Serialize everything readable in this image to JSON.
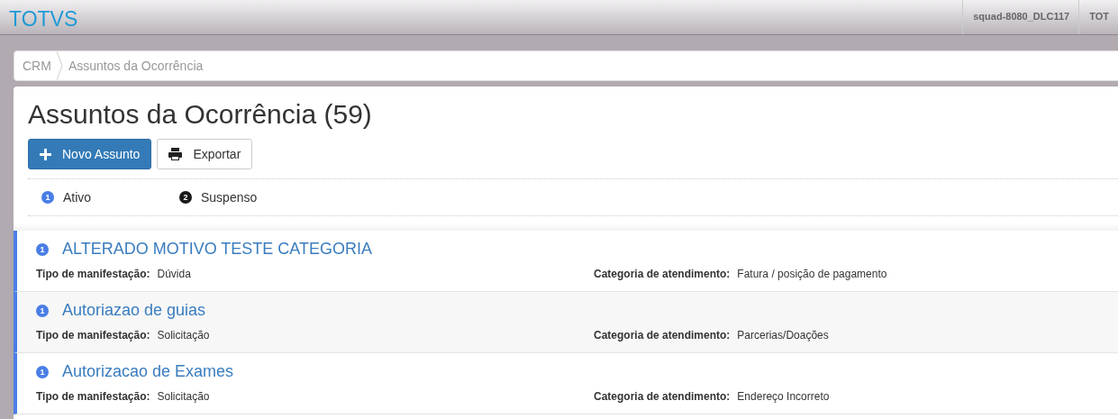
{
  "header": {
    "brand": "TOTVS",
    "items": [
      "squad-8080_DLC117",
      "TOT"
    ]
  },
  "breadcrumb": [
    "CRM",
    "Assuntos da Ocorrência"
  ],
  "page": {
    "title": "Assuntos da Ocorrência (59)",
    "buttons": [
      {
        "kind": "primary",
        "label": "Novo Assunto"
      },
      {
        "kind": "default",
        "label": "Exportar"
      }
    ]
  },
  "legend": [
    {
      "number": "1",
      "label": "Ativo",
      "color": "#4a7ee6"
    },
    {
      "number": "2",
      "label": "Suspenso",
      "color": "#1a1a1a"
    }
  ],
  "items": [
    {
      "status": "1",
      "color": "#4a7ee6",
      "title": "ALTERADO MOTIVO TESTE CATEGORIA",
      "fields": [
        {
          "label": "Tipo de manifestação:",
          "value": "Dúvida"
        },
        {
          "label": "Categoria de atendimento:",
          "value": "Fatura / posição de pagamento"
        }
      ]
    },
    {
      "status": "1",
      "color": "#4a7ee6",
      "title": "Autoriazao de guias",
      "fields": [
        {
          "label": "Tipo de manifestação:",
          "value": "Solicitação"
        },
        {
          "label": "Categoria de atendimento:",
          "value": "Parcerias/Doações"
        }
      ]
    },
    {
      "status": "1",
      "color": "#4a7ee6",
      "title": "Autorizacao de Exames",
      "fields": [
        {
          "label": "Tipo de manifestação:",
          "value": "Solicitação"
        },
        {
          "label": "Categoria de atendimento:",
          "value": "Endereço Incorreto"
        }
      ]
    }
  ]
}
